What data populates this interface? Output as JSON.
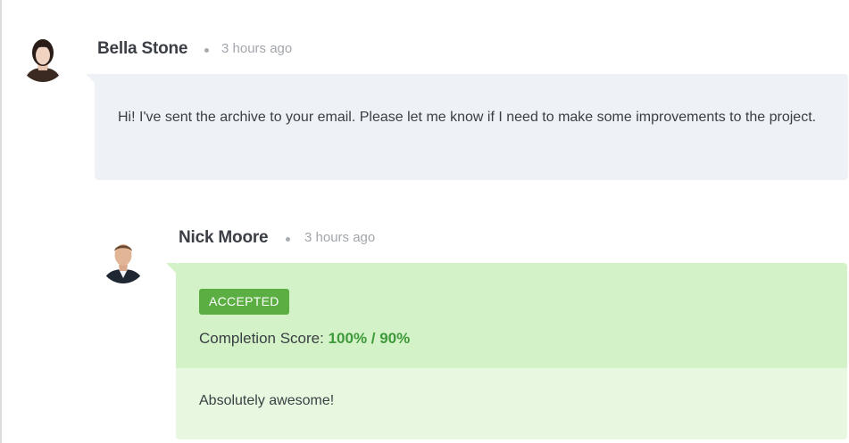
{
  "comment": {
    "author": "Bella Stone",
    "time": "3 hours ago",
    "text": "Hi! I've sent the archive to your email. Please let me know if I need to make some improvements to the project."
  },
  "reply": {
    "author": "Nick Moore",
    "time": "3 hours ago",
    "status": "ACCEPTED",
    "score_label": "Completion Score:",
    "score_value": "100% / 90%",
    "text": "Absolutely awesome!"
  },
  "colors": {
    "comment_bg": "#eef2f7",
    "reply_top_bg": "#d4f2c8",
    "reply_bottom_bg": "#e8f8e0",
    "badge_bg": "#5aae42",
    "score_value": "#3e9a3a"
  }
}
